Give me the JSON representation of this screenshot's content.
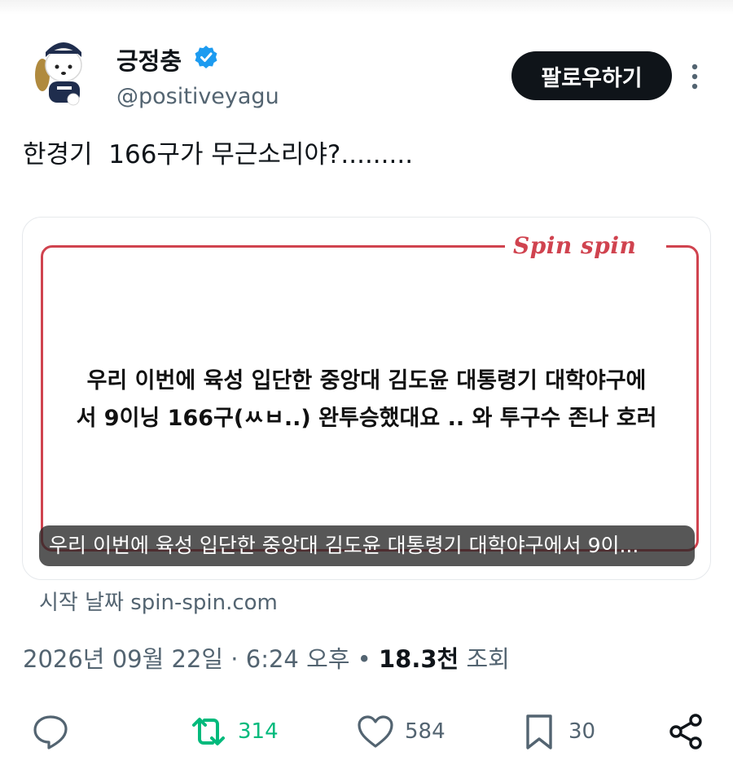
{
  "author": {
    "display_name": "긍정충",
    "handle": "@positiveyagu",
    "verified": true,
    "avatar_icon": "puppy-mascot-avatar"
  },
  "follow_label": "팔로우하기",
  "tweet_text": "한경기  166구가 무근소리야?.........",
  "card": {
    "logo": "Spin spin",
    "body_line1": "우리 이번에 육성 입단한 중앙대 김도윤 대통령기 대학야구에",
    "body_line2": "서 9이닝 166구(ㅆㅂ..) 완투승했대요 .. 와 투구수 존나 호러",
    "caption": "우리 이번에 육성 입단한 중앙대 김도윤 대통령기 대학야구에서 9이...",
    "accent_color": "#d0434f"
  },
  "source": "시작 날짜 spin-spin.com",
  "meta": {
    "datetime": "2026년 09월 22일 · 6:24 오후",
    "separator": " • ",
    "views": "18.3천",
    "views_label": " 조회"
  },
  "actions": {
    "reply_icon": "speech-bubble-icon",
    "retweet_icon": "retweet-icon",
    "retweets": "314",
    "retweet_color": "#00ba7c",
    "like_icon": "heart-icon",
    "likes": "584",
    "bookmark_icon": "bookmark-icon",
    "bookmarks": "30",
    "share_icon": "share-icon"
  }
}
